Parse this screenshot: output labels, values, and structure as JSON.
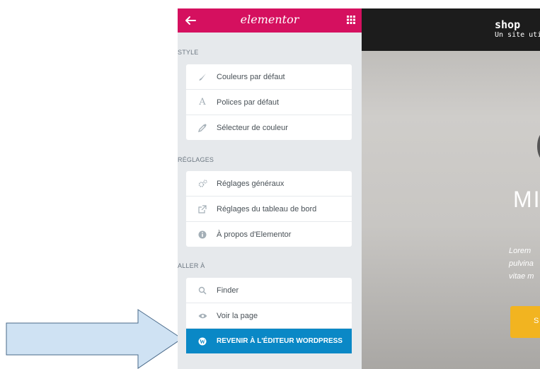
{
  "panel": {
    "logo": "elementor",
    "sections": [
      {
        "title": "STYLE",
        "items": [
          {
            "label": "Couleurs par défaut",
            "icon": "paintbrush-icon"
          },
          {
            "label": "Polices par défaut",
            "icon": "font-a-icon"
          },
          {
            "label": "Sélecteur de couleur",
            "icon": "eyedropper-icon"
          }
        ]
      },
      {
        "title": "RÉGLAGES",
        "items": [
          {
            "label": "Réglages généraux",
            "icon": "cogs-icon"
          },
          {
            "label": "Réglages du tableau de bord",
            "icon": "external-link-icon"
          },
          {
            "label": "À propos d'Elementor",
            "icon": "info-icon"
          }
        ]
      },
      {
        "title": "ALLER À",
        "items": [
          {
            "label": "Finder",
            "icon": "search-icon"
          },
          {
            "label": "Voir la page",
            "icon": "eye-icon"
          },
          {
            "label": "REVENIR À L'ÉDITEUR WORDPRESS",
            "icon": "wordpress-icon"
          }
        ]
      }
    ]
  },
  "preview": {
    "site_title": "shop",
    "site_tagline": "Un site utilis",
    "hero_title": "MI",
    "hero_text": [
      "Lorem",
      "pulvina",
      "vitae m"
    ],
    "hero_button": "S"
  },
  "colors": {
    "brand": "#d5105f",
    "active": "#0a88c6",
    "hero_button": "#f2b420"
  }
}
